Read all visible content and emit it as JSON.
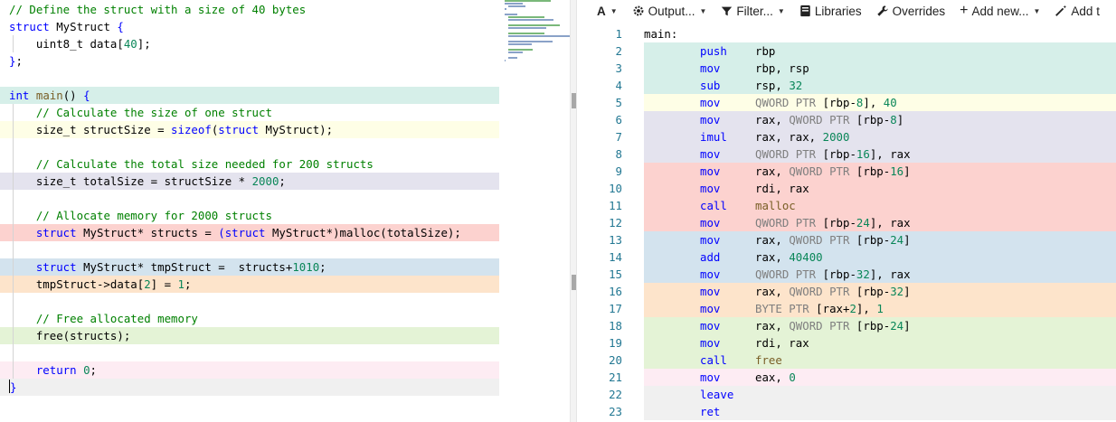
{
  "colors": {
    "band_teal": "#d6efe9",
    "band_yellow": "#fefee6",
    "band_lavender": "#e4e3ee",
    "band_red": "#fcd2cf",
    "band_blue": "#d3e3ee",
    "band_orange": "#fde4cb",
    "band_green": "#e4f3d6",
    "band_pink": "#fdecf3",
    "band_gray": "#f0f0f0"
  },
  "source": {
    "lines": [
      {
        "band": "",
        "guide": false,
        "tokens": [
          {
            "c": "c-com",
            "t": "// Define the struct with a size of 40 bytes"
          }
        ]
      },
      {
        "band": "",
        "guide": false,
        "tokens": [
          {
            "c": "c-key",
            "t": "struct"
          },
          {
            "c": "",
            "t": " MyStruct "
          },
          {
            "c": "c-key",
            "t": "{"
          }
        ]
      },
      {
        "band": "",
        "guide": true,
        "tokens": [
          {
            "c": "",
            "t": "    uint8_t data["
          },
          {
            "c": "c-num",
            "t": "40"
          },
          {
            "c": "",
            "t": "];"
          }
        ]
      },
      {
        "band": "",
        "guide": false,
        "tokens": [
          {
            "c": "c-key",
            "t": "}"
          },
          {
            "c": "",
            "t": ";"
          }
        ]
      },
      {
        "band": "",
        "guide": false,
        "tokens": []
      },
      {
        "band": "band_teal",
        "guide": false,
        "tokens": [
          {
            "c": "c-key",
            "t": "int"
          },
          {
            "c": "",
            "t": " "
          },
          {
            "c": "c-fn",
            "t": "main"
          },
          {
            "c": "",
            "t": "() "
          },
          {
            "c": "c-key",
            "t": "{"
          }
        ]
      },
      {
        "band": "",
        "guide": true,
        "tokens": [
          {
            "c": "",
            "t": "    "
          },
          {
            "c": "c-com",
            "t": "// Calculate the size of one struct"
          }
        ]
      },
      {
        "band": "band_yellow",
        "guide": true,
        "tokens": [
          {
            "c": "",
            "t": "    size_t structSize = "
          },
          {
            "c": "c-key",
            "t": "sizeof"
          },
          {
            "c": "",
            "t": "("
          },
          {
            "c": "c-key",
            "t": "struct"
          },
          {
            "c": "",
            "t": " MyStruct);"
          }
        ]
      },
      {
        "band": "",
        "guide": true,
        "tokens": []
      },
      {
        "band": "",
        "guide": true,
        "tokens": [
          {
            "c": "",
            "t": "    "
          },
          {
            "c": "c-com",
            "t": "// Calculate the total size needed for 200 structs"
          }
        ]
      },
      {
        "band": "band_lavender",
        "guide": true,
        "tokens": [
          {
            "c": "",
            "t": "    size_t totalSize = structSize * "
          },
          {
            "c": "c-num",
            "t": "2000"
          },
          {
            "c": "",
            "t": ";"
          }
        ]
      },
      {
        "band": "",
        "guide": true,
        "tokens": []
      },
      {
        "band": "",
        "guide": true,
        "tokens": [
          {
            "c": "",
            "t": "    "
          },
          {
            "c": "c-com",
            "t": "// Allocate memory for 2000 structs"
          }
        ]
      },
      {
        "band": "band_red",
        "guide": true,
        "tokens": [
          {
            "c": "",
            "t": "    "
          },
          {
            "c": "c-key",
            "t": "struct"
          },
          {
            "c": "",
            "t": " MyStruct* structs = "
          },
          {
            "c": "c-key",
            "t": "(struct"
          },
          {
            "c": "",
            "t": " MyStruct*)malloc(totalSize);"
          }
        ]
      },
      {
        "band": "",
        "guide": true,
        "tokens": []
      },
      {
        "band": "band_blue",
        "guide": true,
        "tokens": [
          {
            "c": "",
            "t": "    "
          },
          {
            "c": "c-key",
            "t": "struct"
          },
          {
            "c": "",
            "t": " MyStruct* tmpStruct =  structs+"
          },
          {
            "c": "c-num",
            "t": "1010"
          },
          {
            "c": "",
            "t": ";"
          }
        ]
      },
      {
        "band": "band_orange",
        "guide": true,
        "tokens": [
          {
            "c": "",
            "t": "    tmpStruct->data["
          },
          {
            "c": "c-num",
            "t": "2"
          },
          {
            "c": "",
            "t": "] = "
          },
          {
            "c": "c-num",
            "t": "1"
          },
          {
            "c": "",
            "t": ";"
          }
        ]
      },
      {
        "band": "",
        "guide": true,
        "tokens": []
      },
      {
        "band": "",
        "guide": true,
        "tokens": [
          {
            "c": "",
            "t": "    "
          },
          {
            "c": "c-com",
            "t": "// Free allocated memory"
          }
        ]
      },
      {
        "band": "band_green",
        "guide": true,
        "tokens": [
          {
            "c": "",
            "t": "    free(structs);"
          }
        ]
      },
      {
        "band": "",
        "guide": true,
        "tokens": []
      },
      {
        "band": "band_pink",
        "guide": true,
        "tokens": [
          {
            "c": "",
            "t": "    "
          },
          {
            "c": "c-key",
            "t": "return"
          },
          {
            "c": "",
            "t": " "
          },
          {
            "c": "c-num",
            "t": "0"
          },
          {
            "c": "",
            "t": ";"
          }
        ]
      },
      {
        "band": "band_gray",
        "guide": false,
        "caret": true,
        "tokens": [
          {
            "c": "c-key",
            "t": "}"
          }
        ]
      }
    ]
  },
  "toolbar": {
    "font_label": "A",
    "output_label": "Output...",
    "filter_label": "Filter...",
    "libraries_label": "Libraries",
    "overrides_label": "Overrides",
    "add_new_label": "Add new...",
    "add_tool_label": "Add t"
  },
  "asm": {
    "lines": [
      {
        "num": "1",
        "band": "",
        "label": "main:",
        "op": "",
        "args": []
      },
      {
        "num": "2",
        "band": "band_teal",
        "label": "",
        "op": "push",
        "args": [
          {
            "c": "",
            "t": "rbp"
          }
        ]
      },
      {
        "num": "3",
        "band": "band_teal",
        "label": "",
        "op": "mov",
        "args": [
          {
            "c": "",
            "t": "rbp, rsp"
          }
        ]
      },
      {
        "num": "4",
        "band": "band_teal",
        "label": "",
        "op": "sub",
        "args": [
          {
            "c": "",
            "t": "rsp, "
          },
          {
            "c": "a-num",
            "t": "32"
          }
        ]
      },
      {
        "num": "5",
        "band": "band_yellow",
        "label": "",
        "op": "mov",
        "args": [
          {
            "c": "a-sz",
            "t": "QWORD PTR"
          },
          {
            "c": "",
            "t": " [rbp-"
          },
          {
            "c": "a-num",
            "t": "8"
          },
          {
            "c": "",
            "t": "], "
          },
          {
            "c": "a-num",
            "t": "40"
          }
        ]
      },
      {
        "num": "6",
        "band": "band_lavender",
        "label": "",
        "op": "mov",
        "args": [
          {
            "c": "",
            "t": "rax, "
          },
          {
            "c": "a-sz",
            "t": "QWORD PTR"
          },
          {
            "c": "",
            "t": " [rbp-"
          },
          {
            "c": "a-num",
            "t": "8"
          },
          {
            "c": "",
            "t": "]"
          }
        ]
      },
      {
        "num": "7",
        "band": "band_lavender",
        "label": "",
        "op": "imul",
        "args": [
          {
            "c": "",
            "t": "rax, rax, "
          },
          {
            "c": "a-num",
            "t": "2000"
          }
        ]
      },
      {
        "num": "8",
        "band": "band_lavender",
        "label": "",
        "op": "mov",
        "args": [
          {
            "c": "a-sz",
            "t": "QWORD PTR"
          },
          {
            "c": "",
            "t": " [rbp-"
          },
          {
            "c": "a-num",
            "t": "16"
          },
          {
            "c": "",
            "t": "], rax"
          }
        ]
      },
      {
        "num": "9",
        "band": "band_red",
        "label": "",
        "op": "mov",
        "args": [
          {
            "c": "",
            "t": "rax, "
          },
          {
            "c": "a-sz",
            "t": "QWORD PTR"
          },
          {
            "c": "",
            "t": " [rbp-"
          },
          {
            "c": "a-num",
            "t": "16"
          },
          {
            "c": "",
            "t": "]"
          }
        ]
      },
      {
        "num": "10",
        "band": "band_red",
        "label": "",
        "op": "mov",
        "args": [
          {
            "c": "",
            "t": "rdi, rax"
          }
        ]
      },
      {
        "num": "11",
        "band": "band_red",
        "label": "",
        "op": "call",
        "args": [
          {
            "c": "a-fn",
            "t": "malloc"
          }
        ]
      },
      {
        "num": "12",
        "band": "band_red",
        "label": "",
        "op": "mov",
        "args": [
          {
            "c": "a-sz",
            "t": "QWORD PTR"
          },
          {
            "c": "",
            "t": " [rbp-"
          },
          {
            "c": "a-num",
            "t": "24"
          },
          {
            "c": "",
            "t": "], rax"
          }
        ]
      },
      {
        "num": "13",
        "band": "band_blue",
        "label": "",
        "op": "mov",
        "args": [
          {
            "c": "",
            "t": "rax, "
          },
          {
            "c": "a-sz",
            "t": "QWORD PTR"
          },
          {
            "c": "",
            "t": " [rbp-"
          },
          {
            "c": "a-num",
            "t": "24"
          },
          {
            "c": "",
            "t": "]"
          }
        ]
      },
      {
        "num": "14",
        "band": "band_blue",
        "label": "",
        "op": "add",
        "args": [
          {
            "c": "",
            "t": "rax, "
          },
          {
            "c": "a-num",
            "t": "40400"
          }
        ]
      },
      {
        "num": "15",
        "band": "band_blue",
        "label": "",
        "op": "mov",
        "args": [
          {
            "c": "a-sz",
            "t": "QWORD PTR"
          },
          {
            "c": "",
            "t": " [rbp-"
          },
          {
            "c": "a-num",
            "t": "32"
          },
          {
            "c": "",
            "t": "], rax"
          }
        ]
      },
      {
        "num": "16",
        "band": "band_orange",
        "label": "",
        "op": "mov",
        "args": [
          {
            "c": "",
            "t": "rax, "
          },
          {
            "c": "a-sz",
            "t": "QWORD PTR"
          },
          {
            "c": "",
            "t": " [rbp-"
          },
          {
            "c": "a-num",
            "t": "32"
          },
          {
            "c": "",
            "t": "]"
          }
        ]
      },
      {
        "num": "17",
        "band": "band_orange",
        "label": "",
        "op": "mov",
        "args": [
          {
            "c": "a-sz",
            "t": "BYTE PTR"
          },
          {
            "c": "",
            "t": " [rax+"
          },
          {
            "c": "a-num",
            "t": "2"
          },
          {
            "c": "",
            "t": "], "
          },
          {
            "c": "a-num",
            "t": "1"
          }
        ]
      },
      {
        "num": "18",
        "band": "band_green",
        "label": "",
        "op": "mov",
        "args": [
          {
            "c": "",
            "t": "rax, "
          },
          {
            "c": "a-sz",
            "t": "QWORD PTR"
          },
          {
            "c": "",
            "t": " [rbp-"
          },
          {
            "c": "a-num",
            "t": "24"
          },
          {
            "c": "",
            "t": "]"
          }
        ]
      },
      {
        "num": "19",
        "band": "band_green",
        "label": "",
        "op": "mov",
        "args": [
          {
            "c": "",
            "t": "rdi, rax"
          }
        ]
      },
      {
        "num": "20",
        "band": "band_green",
        "label": "",
        "op": "call",
        "args": [
          {
            "c": "a-fn",
            "t": "free"
          }
        ]
      },
      {
        "num": "21",
        "band": "band_pink",
        "label": "",
        "op": "mov",
        "args": [
          {
            "c": "",
            "t": "eax, "
          },
          {
            "c": "a-num",
            "t": "0"
          }
        ]
      },
      {
        "num": "22",
        "band": "band_gray",
        "label": "",
        "op": "leave",
        "args": []
      },
      {
        "num": "23",
        "band": "band_gray",
        "label": "",
        "op": "ret",
        "args": []
      }
    ]
  }
}
